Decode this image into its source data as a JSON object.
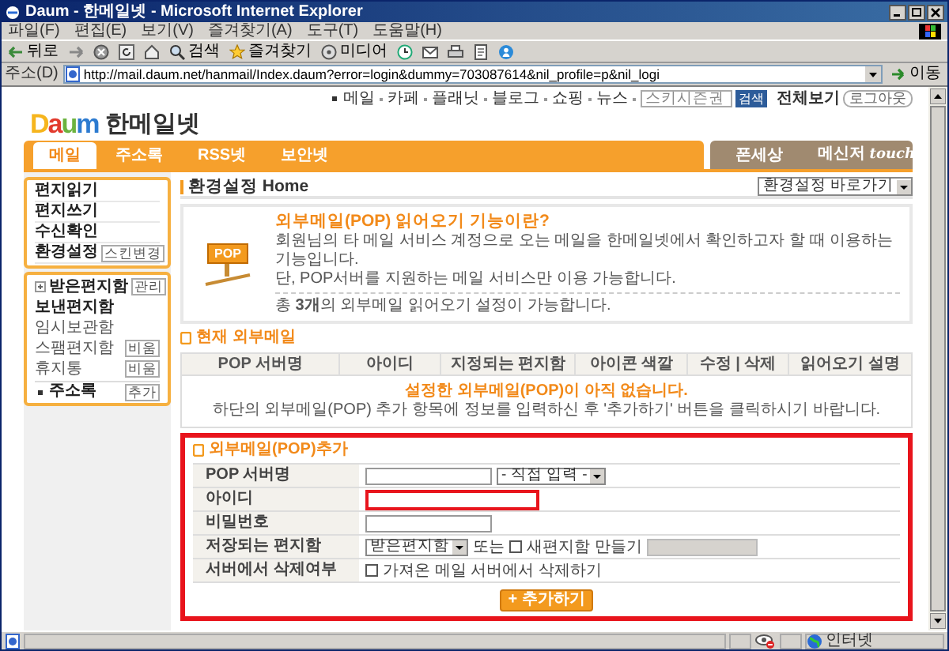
{
  "window": {
    "title": "Daum - 한메일넷 - Microsoft Internet Explorer"
  },
  "menu_bar": [
    "파일(F)",
    "편집(E)",
    "보기(V)",
    "즐겨찾기(A)",
    "도구(T)",
    "도움말(H)"
  ],
  "toolbar": [
    {
      "kind": "back",
      "label": "뒤로"
    },
    {
      "kind": "forward"
    },
    {
      "kind": "stop"
    },
    {
      "kind": "refresh"
    },
    {
      "kind": "home"
    },
    {
      "kind": "search",
      "label": "검색"
    },
    {
      "kind": "favorites",
      "label": "즐겨찾기"
    },
    {
      "kind": "media",
      "label": "미디어"
    },
    {
      "kind": "history"
    },
    {
      "kind": "mail"
    },
    {
      "kind": "print"
    },
    {
      "kind": "edit"
    },
    {
      "kind": "messenger"
    }
  ],
  "address_bar": {
    "label": "주소(D)",
    "url": "http://mail.daum.net/hanmail/Index.daum?error=login&dummy=703087614&nil_profile=p&nil_logi",
    "go": "이동"
  },
  "page": {
    "top_links": [
      "메일",
      "카페",
      "플래닛",
      "블로그",
      "쇼핑",
      "뉴스"
    ],
    "search": {
      "value": "스키시즌권",
      "button": "검색"
    },
    "all_view": "전체보기",
    "logout": "로그아웃",
    "logo": {
      "brand": "Daum",
      "service": "한메일넷"
    },
    "nav": {
      "main": [
        {
          "label": "메일",
          "selected": true
        },
        {
          "label": "주소록",
          "selected": false
        },
        {
          "label": "RSS넷",
          "selected": false
        },
        {
          "label": "보안넷",
          "selected": false
        }
      ],
      "extra": [
        {
          "label": "폰세상",
          "selected": false
        },
        {
          "label": "메신저",
          "badge": "touch",
          "selected": false
        }
      ]
    },
    "sidebar": {
      "actions": [
        {
          "label": "편지읽기"
        },
        {
          "label": "편지쓰기"
        },
        {
          "label": "수신확인"
        },
        {
          "label": "환경설정",
          "button": "스킨변경"
        }
      ],
      "folders": [
        {
          "label": "받은편지함",
          "button": "관리",
          "expanded": false,
          "emphasized": true
        },
        {
          "label": "보낸편지함",
          "emphasized": true
        },
        {
          "label": "임시보관함",
          "emphasized": false
        },
        {
          "label": "스팸편지함",
          "button": "비움",
          "emphasized": false
        },
        {
          "label": "휴지통",
          "button": "비움",
          "emphasized": false
        }
      ],
      "address_book": {
        "label": "주소록",
        "button": "추가"
      }
    },
    "header": {
      "title": "환경설정 Home",
      "jump_select": "환경설정 바로가기"
    },
    "info": {
      "icon_label": "POP",
      "title": "외부메일(POP) 읽어오기 기능이란?",
      "lines": [
        "회원님의 타 메일 서비스 계정으로 오는 메일을 한메일넷에서 확인하고자 할 때 이용하는 기능입니다.",
        "단, POP서버를 지원하는 메일 서비스만 이용 가능합니다."
      ],
      "note": "총 **3개**의 외부메일 읽어오기 설정이 가능합니다."
    },
    "current": {
      "title": "현재 외부메일",
      "columns": [
        "POP 서버명",
        "아이디",
        "지정되는 편지함",
        "아이콘 색깔",
        "수정 | 삭제",
        "읽어오기 설명"
      ],
      "empty_title": "설정한 외부메일(POP)이 아직 없습니다.",
      "empty_hint": "하단의 외부메일(POP) 추가 항목에 정보를 입력하신 후 '추가하기' 버튼을 클릭하시기 바랍니다."
    },
    "add": {
      "title": "외부메일(POP)추가",
      "highlighted": true,
      "rows": [
        {
          "kind": "server",
          "label": "POP 서버명",
          "select": "- 직접 입력 -"
        },
        {
          "kind": "text",
          "label": "아이디",
          "highlighted": true
        },
        {
          "kind": "password",
          "label": "비밀번호",
          "highlighted": false
        },
        {
          "kind": "folder",
          "label": "저장되는 편지함",
          "select": "받은편지함",
          "or": "또는",
          "checkbox": {
            "label": "새편지함 만들기",
            "checked": false
          }
        },
        {
          "kind": "check",
          "label": "서버에서 삭제여부",
          "checkbox": {
            "label": "가져온 메일 서버에서 삭제하기",
            "checked": false
          }
        }
      ],
      "button": "+ 추가하기"
    }
  },
  "status_bar": {
    "zone": "인터넷"
  }
}
